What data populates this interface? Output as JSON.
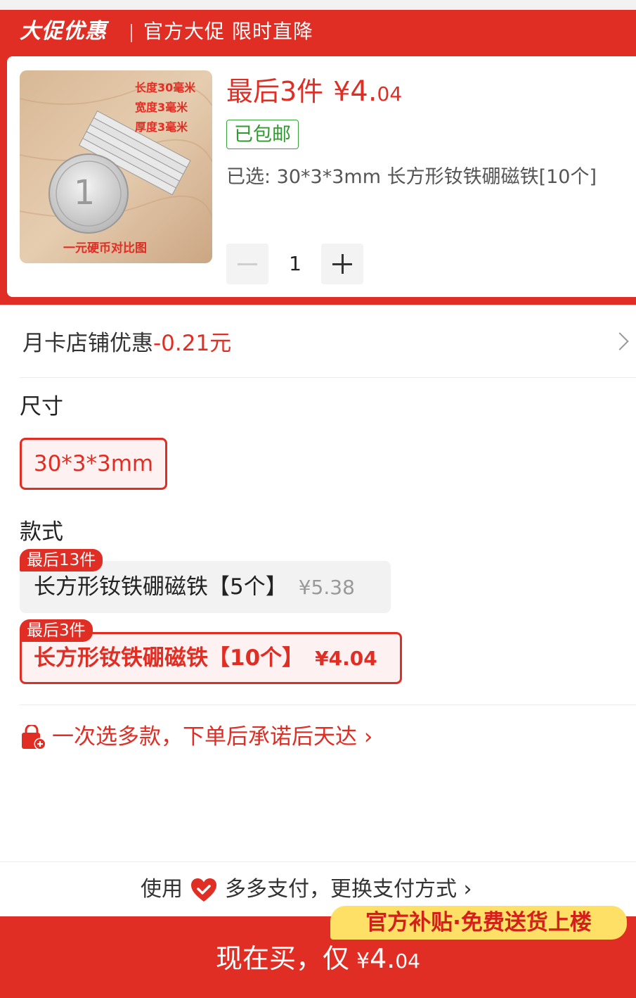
{
  "promo_header": {
    "logo": "大促优惠",
    "slogan": "官方大促 限时直降"
  },
  "product": {
    "image_labels": [
      "长度30毫米",
      "宽度3毫米",
      "厚度3毫米",
      "一元硬币对比图"
    ],
    "stock_text": "最后3件",
    "price_symbol": "¥",
    "price_integer": "4.",
    "price_decimal": "04",
    "shipping_badge": "已包邮",
    "selected_text": "已选: 30*3*3mm 长方形钕铁硼磁铁[10个]",
    "quantity": "1"
  },
  "coupon": {
    "label": "月卡店铺优惠",
    "amount": "-0.21元"
  },
  "size_section": {
    "title": "尺寸",
    "options": [
      "30*3*3mm"
    ]
  },
  "style_section": {
    "title": "款式",
    "options": [
      {
        "stock_tag": "最后13件",
        "name": "长方形钕铁硼磁铁【5个】",
        "price": "¥5.38",
        "selected": false
      },
      {
        "stock_tag": "最后3件",
        "name": "长方形钕铁硼磁铁【10个】",
        "price": "¥4.04",
        "selected": true
      }
    ]
  },
  "multi_select": {
    "text": "一次选多款，下单后承诺后天达 ›"
  },
  "payment": {
    "prefix": "使用",
    "suffix": "多多支付，更换支付方式 ›"
  },
  "buy_bar": {
    "label": "现在买，仅",
    "price_symbol": "¥",
    "price_integer": "4.",
    "price_decimal": "04",
    "subsidy_badge": "官方补贴·免费送货上楼"
  },
  "colors": {
    "brand_red": "#e02e24",
    "ship_green": "#2e9b2e",
    "badge_yellow": "#ffe066"
  },
  "icons": [
    "chevron-right-icon",
    "minus-icon",
    "plus-icon",
    "shopping-bag-plus-icon",
    "heart-pay-icon"
  ]
}
